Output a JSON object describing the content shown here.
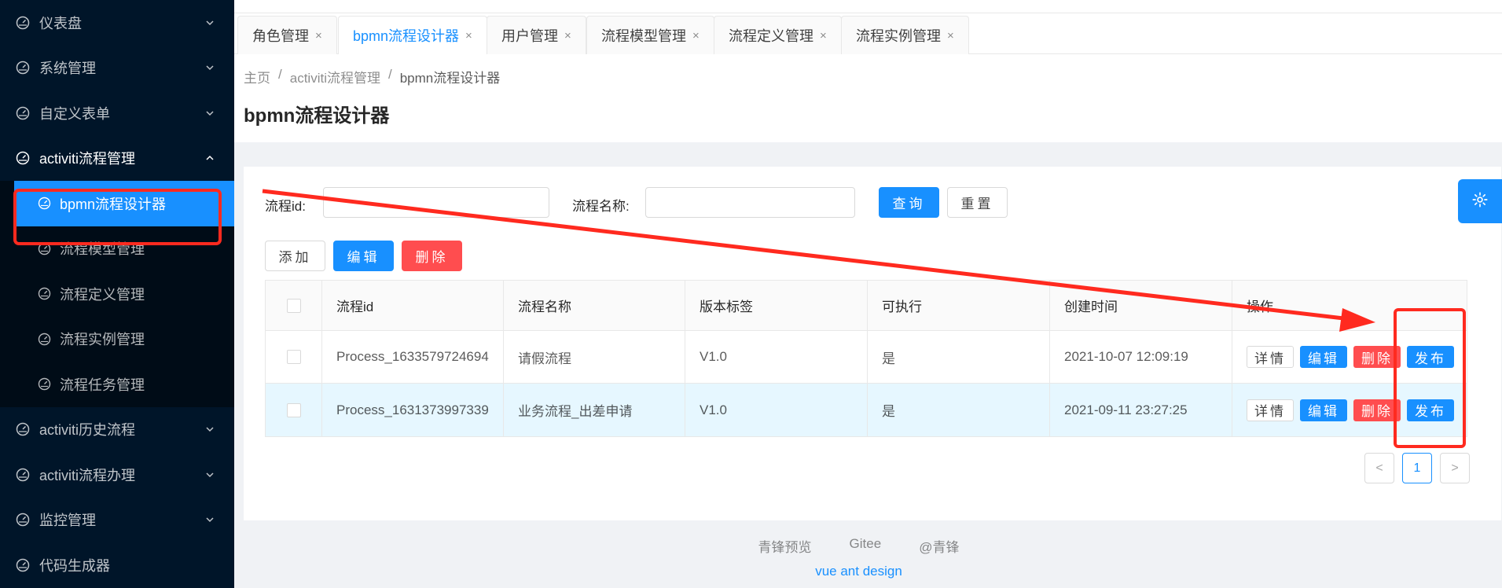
{
  "sidebar": {
    "items": [
      {
        "label": "仪表盘"
      },
      {
        "label": "系统管理"
      },
      {
        "label": "自定义表单"
      },
      {
        "label": "activiti流程管理"
      },
      {
        "label": "activiti历史流程"
      },
      {
        "label": "activiti流程办理"
      },
      {
        "label": "监控管理"
      },
      {
        "label": "代码生成器"
      }
    ],
    "submenu": [
      {
        "label": "bpmn流程设计器"
      },
      {
        "label": "流程模型管理"
      },
      {
        "label": "流程定义管理"
      },
      {
        "label": "流程实例管理"
      },
      {
        "label": "流程任务管理"
      }
    ]
  },
  "tabs": [
    {
      "label": "角色管理",
      "close": "×"
    },
    {
      "label": "bpmn流程设计器",
      "close": "×"
    },
    {
      "label": "用户管理",
      "close": "×"
    },
    {
      "label": "流程模型管理",
      "close": "×"
    },
    {
      "label": "流程定义管理",
      "close": "×"
    },
    {
      "label": "流程实例管理",
      "close": "×"
    }
  ],
  "breadcrumb": {
    "home": "主页",
    "sep": "/",
    "parent": "activiti流程管理",
    "current": "bpmn流程设计器"
  },
  "page": {
    "title": "bpmn流程设计器"
  },
  "search": {
    "id_label": "流程id:",
    "name_label": "流程名称:",
    "query": "查询",
    "reset": "重置"
  },
  "toolbar": {
    "add": "添加",
    "edit": "编辑",
    "delete": "删除"
  },
  "table": {
    "headers": [
      "流程id",
      "流程名称",
      "版本标签",
      "可执行",
      "创建时间",
      "操作"
    ],
    "rows": [
      {
        "id": "Process_1633579724694",
        "name": "请假流程",
        "version": "V1.0",
        "executable": "是",
        "created": "2021-10-07 12:09:19"
      },
      {
        "id": "Process_1631373997339",
        "name": "业务流程_出差申请",
        "version": "V1.0",
        "executable": "是",
        "created": "2021-09-11 23:27:25"
      }
    ],
    "actions": {
      "detail": "详情",
      "edit": "编辑",
      "delete": "删除",
      "publish": "发布"
    }
  },
  "pagination": {
    "prev": "<",
    "current": "1",
    "next": ">"
  },
  "footer": {
    "links": [
      "青锋预览",
      "Gitee",
      "@青锋"
    ],
    "sub": "vue ant design"
  },
  "colors": {
    "sidebar_bg": "#001529",
    "primary": "#1890ff",
    "danger": "#ff4d4f",
    "annotation": "#ff2a1f"
  },
  "icons": {
    "menu": "dashboard-icon",
    "chevron": "chevron-down-icon",
    "settings": "gear-icon"
  }
}
